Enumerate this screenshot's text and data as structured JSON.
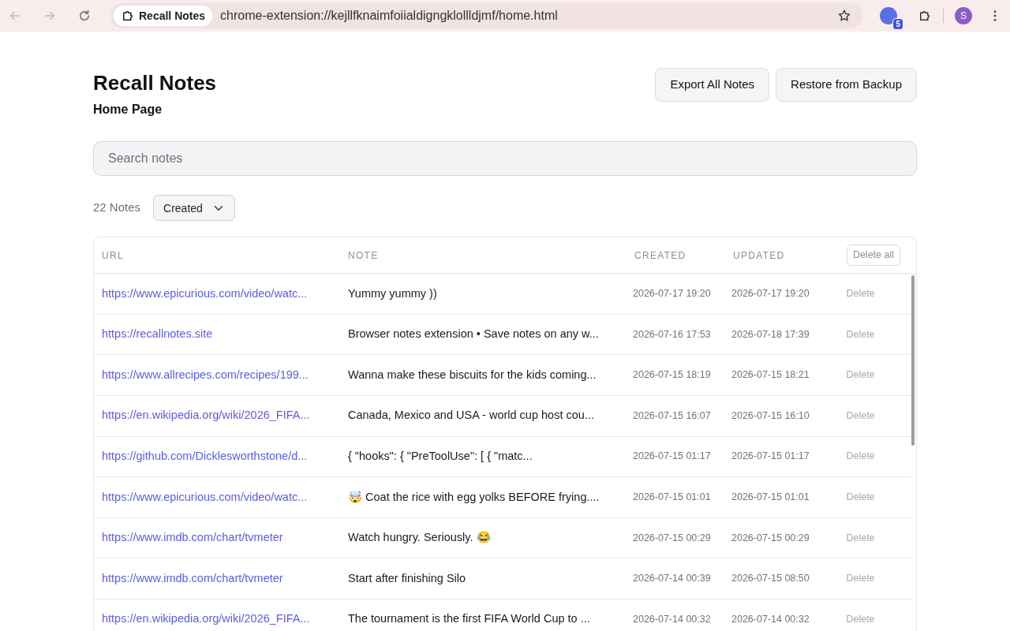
{
  "browser": {
    "tab_chip": "Recall Notes",
    "address": "chrome-extension://kejllfknaimfoiialdigngklollldjmf/home.html",
    "extension_badge": "5",
    "avatar": "S"
  },
  "header": {
    "title": "Recall Notes",
    "subtitle": "Home Page",
    "buttons": [
      "Export All Notes",
      "Restore from Backup"
    ]
  },
  "search": {
    "placeholder": "Search notes"
  },
  "toolbar": {
    "count": "22 Notes",
    "sort": "Created"
  },
  "table": {
    "columns": [
      "URL",
      "NOTE",
      "CREATED",
      "UPDATED"
    ],
    "delete_all": "Delete all",
    "rows": [
      {
        "url": "https://www.epicurious.com/video/watc...",
        "note": "Yummy yummy ))",
        "created": "2026-07-17 19:20",
        "updated": "2026-07-17 19:20",
        "action": "Delete"
      },
      {
        "url": "https://recallnotes.site",
        "note": "Browser notes extension • Save notes on any w...",
        "created": "2026-07-16 17:53",
        "updated": "2026-07-18 17:39",
        "action": "Delete"
      },
      {
        "url": "https://www.allrecipes.com/recipes/199...",
        "note": "Wanna make these biscuits for the kids coming...",
        "created": "2026-07-15 18:19",
        "updated": "2026-07-15 18:21",
        "action": "Delete"
      },
      {
        "url": "https://en.wikipedia.org/wiki/2026_FIFA...",
        "note": "Canada, Mexico and USA - world cup host cou...",
        "created": "2026-07-15 16:07",
        "updated": "2026-07-15 16:10",
        "action": "Delete"
      },
      {
        "url": "https://github.com/Dicklesworthstone/d...",
        "note": "{ \"hooks\": { \"PreToolUse\": [ { \"matc...",
        "created": "2026-07-15 01:17",
        "updated": "2026-07-15 01:17",
        "action": "Delete"
      },
      {
        "url": "https://www.epicurious.com/video/watc...",
        "note": "🤯 Coat the rice with egg yolks BEFORE frying....",
        "created": "2026-07-15 01:01",
        "updated": "2026-07-15 01:01",
        "action": "Delete"
      },
      {
        "url": "https://www.imdb.com/chart/tvmeter",
        "note": "Watch hungry. Seriously. 😂",
        "created": "2026-07-15 00:29",
        "updated": "2026-07-15 00:29",
        "action": "Delete"
      },
      {
        "url": "https://www.imdb.com/chart/tvmeter",
        "note": "Start after finishing Silo",
        "created": "2026-07-14 00:39",
        "updated": "2026-07-15 08:50",
        "action": "Delete"
      },
      {
        "url": "https://en.wikipedia.org/wiki/2026_FIFA...",
        "note": "The tournament is the first FIFA World Cup to ...",
        "created": "2026-07-14 00:32",
        "updated": "2026-07-14 00:32",
        "action": "Delete"
      }
    ]
  }
}
